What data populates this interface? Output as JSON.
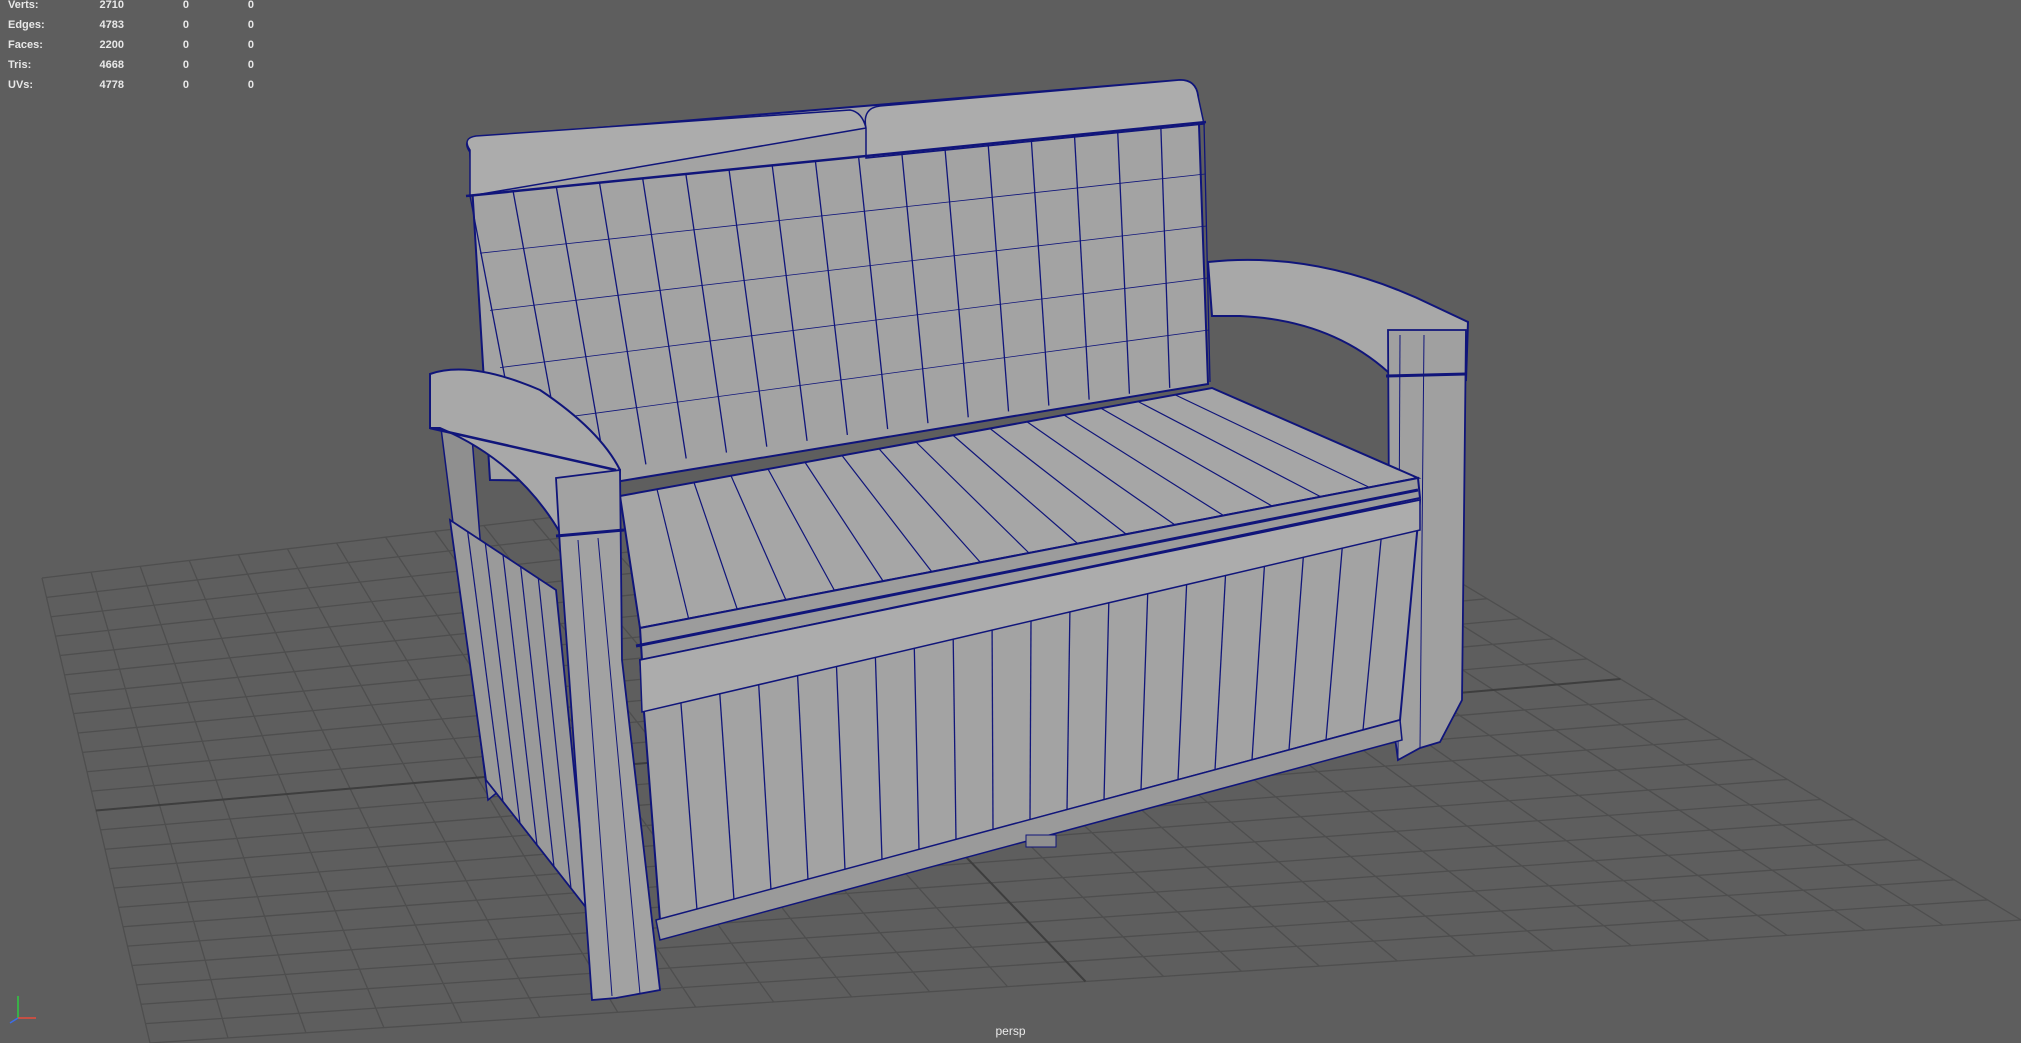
{
  "hud": {
    "rows": [
      {
        "label": "Verts:",
        "v1": "2710",
        "v2": "0",
        "v3": "0"
      },
      {
        "label": "Edges:",
        "v1": "4783",
        "v2": "0",
        "v3": "0"
      },
      {
        "label": "Faces:",
        "v1": "2200",
        "v2": "0",
        "v3": "0"
      },
      {
        "label": "Tris:",
        "v1": "4668",
        "v2": "0",
        "v3": "0"
      },
      {
        "label": "UVs:",
        "v1": "4778",
        "v2": "0",
        "v3": "0"
      }
    ]
  },
  "viewport": {
    "camera": "persp",
    "background": "#5e5e5e",
    "grid_color": "#4e4e4e",
    "model_color": "#a3a3a3",
    "wire_color": "#10157a"
  },
  "axis_icons": [
    "x-axis-icon",
    "y-axis-icon",
    "z-axis-icon"
  ]
}
